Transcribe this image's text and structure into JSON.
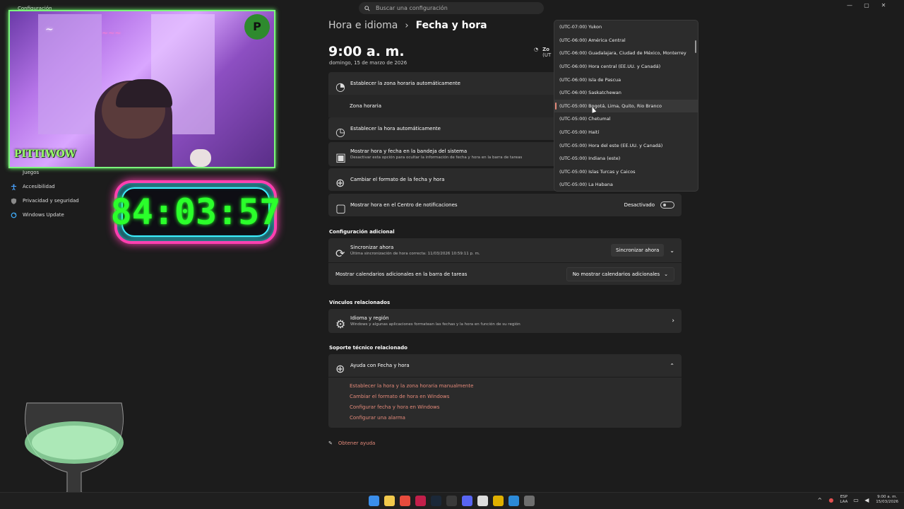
{
  "window": {
    "title": "Configuración",
    "controls": {
      "minimize": "—",
      "maximize": "▢",
      "close": "✕"
    }
  },
  "search": {
    "placeholder": "Buscar una configuración"
  },
  "sidebar": {
    "items": [
      {
        "label": "Juegos",
        "icon": "gamepad-icon"
      },
      {
        "label": "Accesibilidad",
        "icon": "accessibility-icon"
      },
      {
        "label": "Privacidad y seguridad",
        "icon": "shield-icon"
      },
      {
        "label": "Windows Update",
        "icon": "update-icon"
      }
    ]
  },
  "overlay": {
    "timer": "84:03:57",
    "brand": "PITTIWOW",
    "logo_letter": "P"
  },
  "breadcrumb": {
    "parent": "Hora e idioma",
    "separator": "›",
    "current": "Fecha y hora"
  },
  "clock": {
    "time": "9:00 a. m.",
    "date": "domingo, 15 de marzo de 2026"
  },
  "zone_header": {
    "label": "Zo",
    "sub": "(UT"
  },
  "settings": {
    "auto_timezone": "Establecer la zona horaria automáticamente",
    "timezone": "Zona horaria",
    "auto_time": "Establecer la hora automáticamente",
    "systray_title": "Mostrar hora y fecha en la bandeja del sistema",
    "systray_sub": "Desactivar esta opción para ocultar la información de fecha y hora en la barra de tareas",
    "format": "Cambiar el formato de la fecha y hora",
    "notif_center": "Mostrar hora en el Centro de notificaciones",
    "notif_center_state": "Desactivado"
  },
  "additional": {
    "heading": "Configuración adicional",
    "sync_title": "Sincronizar ahora",
    "sync_sub": "Última sincronización de hora correcta: 11/03/2026 10:59:11 p. m.",
    "sync_button": "Sincronizar ahora",
    "calendars_label": "Mostrar calendarios adicionales en la barra de tareas",
    "calendars_value": "No mostrar calendarios adicionales"
  },
  "related_links": {
    "heading": "Vínculos relacionados",
    "lang_title": "Idioma y región",
    "lang_sub": "Windows y algunas aplicaciones formatean las fechas y la hora en función de su región"
  },
  "support": {
    "heading": "Soporte técnico relacionado",
    "help_title": "Ayuda con Fecha y hora",
    "links": [
      "Establecer la hora y la zona horaria manualmente",
      "Cambiar el formato de hora en Windows",
      "Configurar fecha y hora en Windows",
      "Configurar una alarma"
    ]
  },
  "get_help": "Obtener ayuda",
  "timezones": [
    "(UTC-07:00) Yukon",
    "(UTC-06:00) América Central",
    "(UTC-06:00) Guadalajara, Ciudad de México, Monterrey",
    "(UTC-06:00) Hora central (EE.UU. y Canadá)",
    "(UTC-06:00) Isla de Pascua",
    "(UTC-06:00) Saskatchewan",
    "(UTC-05:00) Bogotá, Lima, Quito, Rio Branco",
    "(UTC-05:00) Chetumal",
    "(UTC-05:00) Haití",
    "(UTC-05:00) Hora del este (EE.UU. y Canadá)",
    "(UTC-05:00) Indiana (este)",
    "(UTC-05:00) Islas Turcas y Caicos",
    "(UTC-05:00) La Habana"
  ],
  "timezone_selected_index": 6,
  "taskbar": {
    "apps": [
      {
        "name": "start-icon",
        "color": "#3b8eea"
      },
      {
        "name": "file-explorer-icon",
        "color": "#f2c94c"
      },
      {
        "name": "chrome-icon",
        "color": "#e84c3d"
      },
      {
        "name": "adobe-icon",
        "color": "#c21f4a"
      },
      {
        "name": "steam-icon",
        "color": "#1b2838"
      },
      {
        "name": "obs-icon",
        "color": "#3a3a3a"
      },
      {
        "name": "discord-icon",
        "color": "#5865f2"
      },
      {
        "name": "notepad-icon",
        "color": "#dddddd"
      },
      {
        "name": "app-yellow-icon",
        "color": "#e0b000"
      },
      {
        "name": "photos-icon",
        "color": "#2c8ad8"
      },
      {
        "name": "settings-icon",
        "color": "#6e6e6e"
      }
    ],
    "lang_top": "ESP",
    "lang_bottom": "LAA",
    "time": "9:00 a. m.",
    "date": "15/03/2026"
  },
  "colors": {
    "accent": "#e58a7a",
    "card": "#2b2b2b",
    "background": "#1c1c1c"
  }
}
